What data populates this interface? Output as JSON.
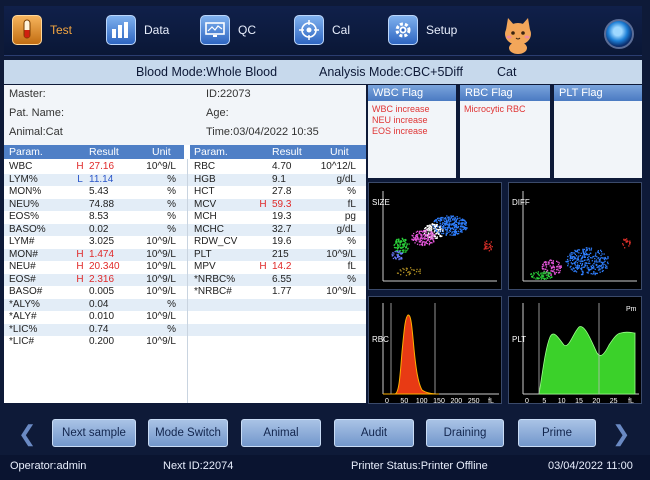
{
  "nav": {
    "items": [
      {
        "label": "Test",
        "icon": "test-tube-icon",
        "active": true
      },
      {
        "label": "Data",
        "icon": "bar-chart-icon",
        "active": false
      },
      {
        "label": "QC",
        "icon": "monitor-icon",
        "active": false
      },
      {
        "label": "Cal",
        "icon": "target-icon",
        "active": false
      },
      {
        "label": "Setup",
        "icon": "gear-icon",
        "active": false
      }
    ]
  },
  "mode": {
    "blood_mode": "Blood Mode:Whole Blood",
    "analysis_mode": "Analysis Mode:CBC+5Diff",
    "species": "Cat"
  },
  "patient": {
    "master": "Master:",
    "id": "ID:22073",
    "pat_name": "Pat. Name:",
    "age": "Age:",
    "animal": "Animal:Cat",
    "time": "Time:03/04/2022 10:35"
  },
  "table": {
    "headers": {
      "param": "Param.",
      "result": "Result",
      "unit": "Unit"
    },
    "left": [
      {
        "param": "WBC",
        "flag": "H",
        "result": "27.16",
        "unit": "10^9/L"
      },
      {
        "param": "LYM%",
        "flag": "L",
        "result": "11.14",
        "unit": "%"
      },
      {
        "param": "MON%",
        "flag": "",
        "result": "5.43",
        "unit": "%"
      },
      {
        "param": "NEU%",
        "flag": "",
        "result": "74.88",
        "unit": "%"
      },
      {
        "param": "EOS%",
        "flag": "",
        "result": "8.53",
        "unit": "%"
      },
      {
        "param": "BASO%",
        "flag": "",
        "result": "0.02",
        "unit": "%"
      },
      {
        "param": "LYM#",
        "flag": "",
        "result": "3.025",
        "unit": "10^9/L"
      },
      {
        "param": "MON#",
        "flag": "H",
        "result": "1.474",
        "unit": "10^9/L"
      },
      {
        "param": "NEU#",
        "flag": "H",
        "result": "20.340",
        "unit": "10^9/L"
      },
      {
        "param": "EOS#",
        "flag": "H",
        "result": "2.316",
        "unit": "10^9/L"
      },
      {
        "param": "BASO#",
        "flag": "",
        "result": "0.005",
        "unit": "10^9/L"
      },
      {
        "param": "*ALY%",
        "flag": "",
        "result": "0.04",
        "unit": "%"
      },
      {
        "param": "*ALY#",
        "flag": "",
        "result": "0.010",
        "unit": "10^9/L"
      },
      {
        "param": "*LIC%",
        "flag": "",
        "result": "0.74",
        "unit": "%"
      },
      {
        "param": "*LIC#",
        "flag": "",
        "result": "0.200",
        "unit": "10^9/L"
      }
    ],
    "right": [
      {
        "param": "RBC",
        "flag": "",
        "result": "4.70",
        "unit": "10^12/L"
      },
      {
        "param": "HGB",
        "flag": "",
        "result": "9.1",
        "unit": "g/dL"
      },
      {
        "param": "HCT",
        "flag": "",
        "result": "27.8",
        "unit": "%"
      },
      {
        "param": "MCV",
        "flag": "H",
        "result": "59.3",
        "unit": "fL"
      },
      {
        "param": "MCH",
        "flag": "",
        "result": "19.3",
        "unit": "pg"
      },
      {
        "param": "MCHC",
        "flag": "",
        "result": "32.7",
        "unit": "g/dL"
      },
      {
        "param": "RDW_CV",
        "flag": "",
        "result": "19.6",
        "unit": "%"
      },
      {
        "param": "PLT",
        "flag": "",
        "result": "215",
        "unit": "10^9/L"
      },
      {
        "param": "MPV",
        "flag": "H",
        "result": "14.2",
        "unit": "fL"
      },
      {
        "param": "*NRBC%",
        "flag": "",
        "result": "6.55",
        "unit": "%"
      },
      {
        "param": "*NRBC#",
        "flag": "",
        "result": "1.77",
        "unit": "10^9/L"
      }
    ]
  },
  "flags": {
    "wbc": {
      "title": "WBC Flag",
      "items": [
        "WBC increase",
        "NEU increase",
        "EOS increase"
      ]
    },
    "rbc": {
      "title": "RBC Flag",
      "items": [
        "Microcytic RBC"
      ]
    },
    "plt": {
      "title": "PLT Flag",
      "items": []
    }
  },
  "plots": {
    "size_label": "SIZE",
    "diff_label": "DIFF",
    "rbc_label": "RBC",
    "plt_label": "PLT",
    "rbc_ticks": [
      "0",
      "50",
      "100",
      "150",
      "200",
      "250",
      "fL"
    ],
    "plt_ticks": [
      "0",
      "5",
      "10",
      "15",
      "20",
      "25",
      "fL"
    ],
    "plt_marker": "Pm"
  },
  "buttons": [
    "Next sample",
    "Mode Switch",
    "Animal",
    "Audit",
    "Draining",
    "Prime"
  ],
  "status": {
    "operator": "Operator:admin",
    "next_id": "Next ID:22074",
    "printer": "Printer Status:Printer Offline",
    "datetime": "03/04/2022 11:00"
  },
  "colors": {
    "active_nav": "#f3a540",
    "flag_high": "#e02a2a",
    "flag_low": "#2a55c8",
    "flag_text": "#e03535",
    "rbc_curve": "#e83a14",
    "plt_curve": "#3bd12a"
  }
}
